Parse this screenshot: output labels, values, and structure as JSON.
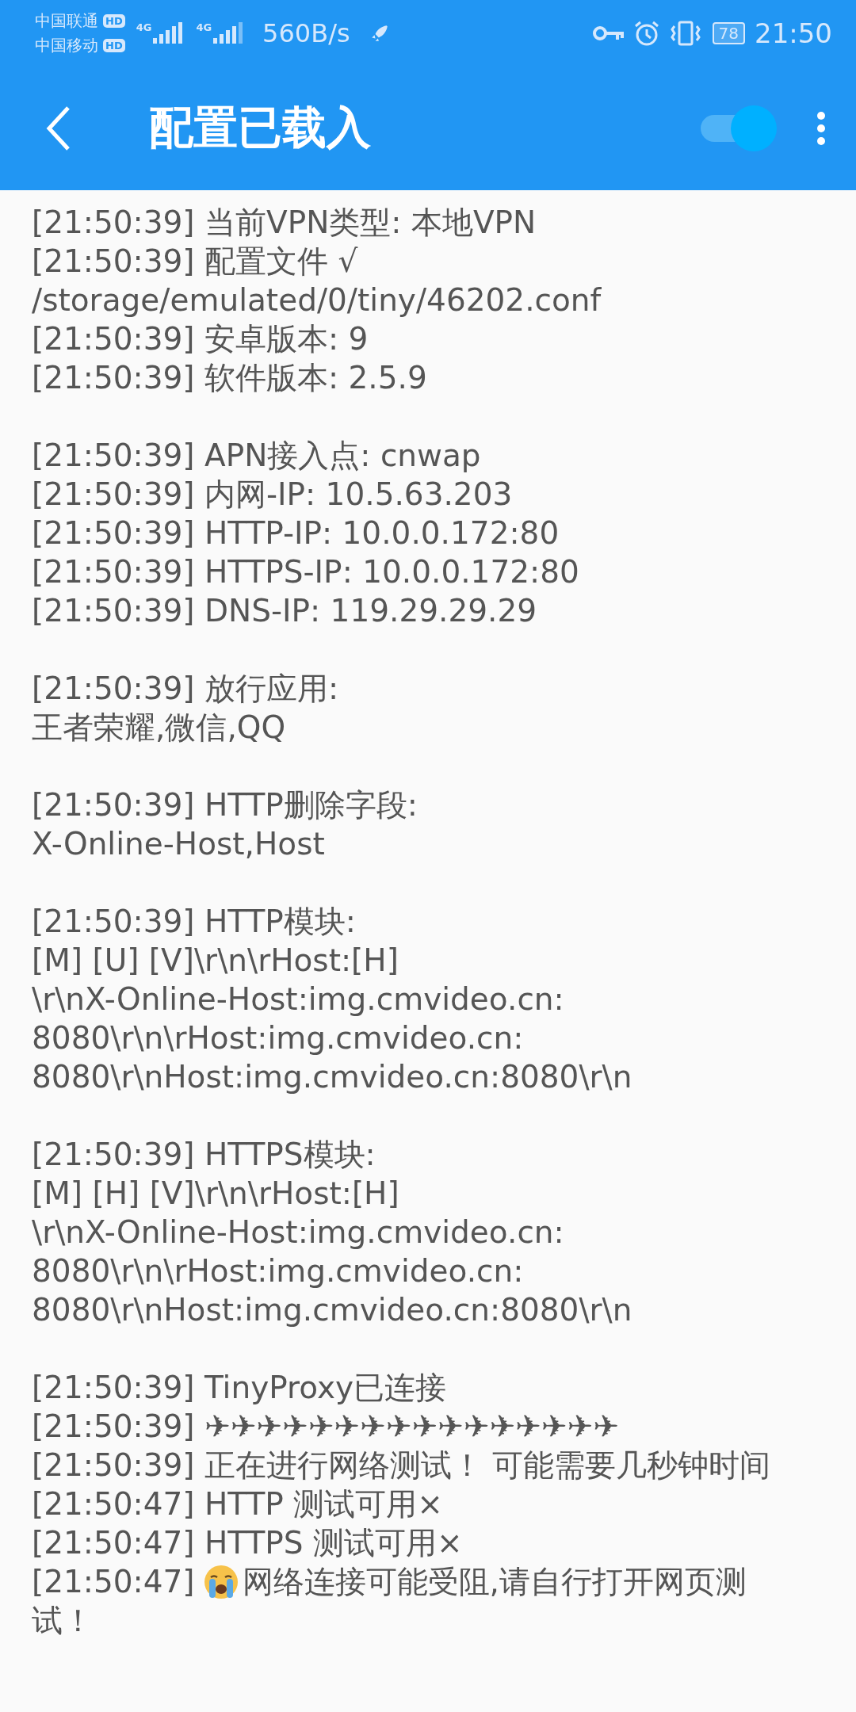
{
  "status_bar": {
    "carriers": [
      {
        "name": "中国联通",
        "badge": "HD"
      },
      {
        "name": "中国移动",
        "badge": "HD"
      }
    ],
    "network": [
      "4G",
      "4G"
    ],
    "speed": "560B/s",
    "battery": "78",
    "time": "21:50"
  },
  "header": {
    "title": "配置已载入",
    "switch": {
      "on": true
    }
  },
  "log": [
    {
      "lines": [
        {
          "text": "[21:50:39] 当前VPN类型: 本地VPN"
        },
        {
          "text": "[21:50:39] 配置文件 √"
        },
        {
          "text": "/storage/emulated/0/tiny/46202.conf"
        },
        {
          "text": "[21:50:39] 安卓版本: 9"
        },
        {
          "text": "[21:50:39] 软件版本: 2.5.9"
        }
      ]
    },
    {
      "lines": [
        {
          "text": "[21:50:39] APN接入点: cnwap"
        },
        {
          "text": "[21:50:39] 内网-IP: 10.5.63.203"
        },
        {
          "text": "[21:50:39] HTTP-IP: 10.0.0.172:80"
        },
        {
          "text": "[21:50:39] HTTPS-IP: 10.0.0.172:80"
        },
        {
          "text": "[21:50:39] DNS-IP: 119.29.29.29"
        }
      ]
    },
    {
      "lines": [
        {
          "text": "[21:50:39] 放行应用:"
        },
        {
          "text": "王者荣耀,微信,QQ"
        }
      ]
    },
    {
      "lines": [
        {
          "text": "[21:50:39] HTTP删除字段:"
        },
        {
          "text": "X-Online-Host,Host"
        }
      ]
    },
    {
      "lines": [
        {
          "text": "[21:50:39] HTTP模块:"
        },
        {
          "text": "[M] [U] [V]\\r\\n\\rHost:[H]"
        },
        {
          "text": "\\r\\nX-Online-Host:img.cmvideo.cn:"
        },
        {
          "text": "8080\\r\\n\\rHost:img.cmvideo.cn:"
        },
        {
          "text": "8080\\r\\nHost:img.cmvideo.cn:8080\\r\\n"
        }
      ]
    },
    {
      "lines": [
        {
          "text": "[21:50:39] HTTPS模块:"
        },
        {
          "text": "[M] [H] [V]\\r\\n\\rHost:[H]"
        },
        {
          "text": "\\r\\nX-Online-Host:img.cmvideo.cn:"
        },
        {
          "text": "8080\\r\\n\\rHost:img.cmvideo.cn:"
        },
        {
          "text": "8080\\r\\nHost:img.cmvideo.cn:8080\\r\\n"
        }
      ]
    },
    {
      "lines": [
        {
          "text": "[21:50:39] TinyProxy已连接"
        },
        {
          "text": "[21:50:39] ✈✈✈✈✈✈✈✈✈✈✈✈✈✈✈✈"
        },
        {
          "text": "[21:50:39] 正在进行网络测试！ 可能需要几秒钟时间"
        },
        {
          "text": "[21:50:47] HTTP 测试可用×"
        },
        {
          "text": "[21:50:47] HTTPS 测试可用×"
        },
        {
          "kind": "emoji",
          "time": "[21:50:47]",
          "text": "网络连接可能受阻,请自行打开网页测"
        },
        {
          "text": "试！"
        }
      ]
    }
  ]
}
